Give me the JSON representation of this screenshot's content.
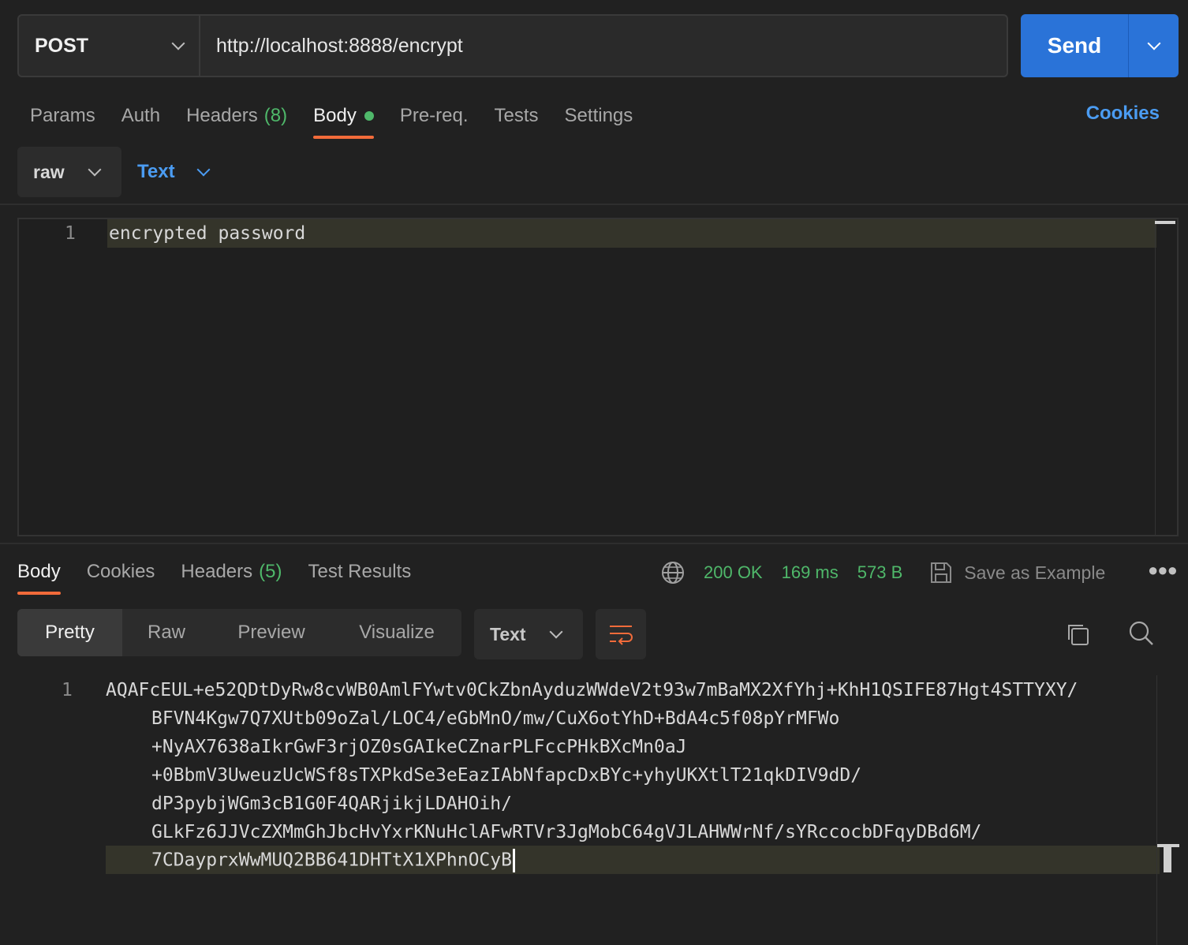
{
  "request": {
    "method": "POST",
    "url": "http://localhost:8888/encrypt",
    "send_label": "Send",
    "tabs": [
      {
        "label": "Params"
      },
      {
        "label": "Auth"
      },
      {
        "label": "Headers",
        "count": "(8)"
      },
      {
        "label": "Body",
        "active": true
      },
      {
        "label": "Pre-req."
      },
      {
        "label": "Tests"
      },
      {
        "label": "Settings"
      }
    ],
    "cookies_label": "Cookies",
    "body_mode": "raw",
    "body_format": "Text",
    "body_lines": [
      {
        "num": "1",
        "text": "encrypted password"
      }
    ]
  },
  "response": {
    "tabs": [
      {
        "label": "Body",
        "active": true
      },
      {
        "label": "Cookies"
      },
      {
        "label": "Headers",
        "count": "(5)"
      },
      {
        "label": "Test Results"
      }
    ],
    "status": "200 OK",
    "time": "169 ms",
    "size": "573 B",
    "save_example_label": "Save as Example",
    "view_modes": [
      "Pretty",
      "Raw",
      "Preview",
      "Visualize"
    ],
    "active_view_mode": "Pretty",
    "format": "Text",
    "line_number": "1",
    "body_wrapped_lines": [
      "AQAFcEUL+e52QDtDyRw8cvWB0AmlFYwtv0CkZbnAyduzWWdeV2t93w7mBaMX2XfYhj+KhH1QSIFE87Hgt4STTYXY/",
      "BFVN4Kgw7Q7XUtb09oZal/LOC4/eGbMnO/mw/CuX6otYhD+BdA4c5f08pYrMFWo",
      "+NyAX7638aIkrGwF3rjOZ0sGAIkeCZnarPLFccPHkBXcMn0aJ",
      "+0BbmV3UweuzUcWSf8sTXPkdSe3eEazIAbNfapcDxBYc+yhyUKXtlT21qkDIV9dD/",
      "dP3pybjWGm3cB1G0F4QARjikjLDAHOih/",
      "GLkFz6JJVcZXMmGhJbcHvYxrKNuHclAFwRTVr3JgMobC64gVJLAHWWrNf/sYRccocbDFqyDBd6M/",
      "7CDayprxWwMUQ2BB641DHTtX1XPhnOCyB"
    ]
  },
  "colors": {
    "accent_send": "#2a73d8",
    "active_tab_underline": "#f26b3a",
    "status_green": "#4fb86a",
    "link_blue": "#4b9cf2"
  }
}
